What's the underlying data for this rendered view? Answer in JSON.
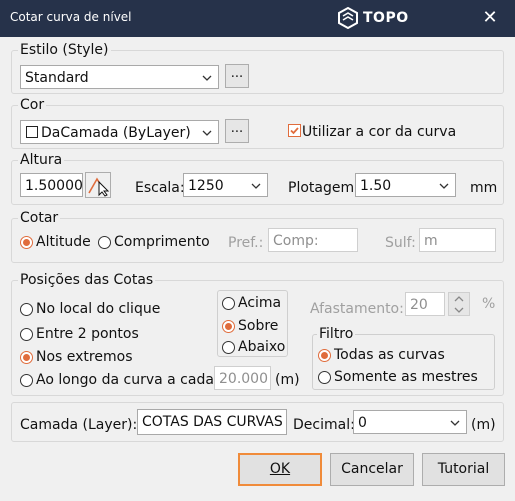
{
  "window": {
    "title": "Cotar curva de nível",
    "logo_text": "TOPO",
    "close_glyph": "✕"
  },
  "estilo": {
    "legend": "Estilo (Style)",
    "value": "Standard",
    "more_label": "..."
  },
  "cor": {
    "legend": "Cor",
    "value": "DaCamada (ByLayer)",
    "more_label": "...",
    "use_curve_color_label": "Utilizar a cor da curva",
    "use_curve_color_checked": true
  },
  "altura": {
    "legend": "Altura",
    "value": "1.50000",
    "escala_label": "Escala:",
    "escala_value": "1250",
    "plotagem_label": "Plotagem:",
    "plotagem_value": "1.50",
    "unit": "mm"
  },
  "cotar": {
    "legend": "Cotar",
    "options": [
      {
        "label": "Altitude",
        "checked": true
      },
      {
        "label": "Comprimento",
        "checked": false
      }
    ],
    "pref_label": "Pref.:",
    "pref_placeholder": "Comp:",
    "sulf_label": "Sulf:",
    "sulf_placeholder": "m"
  },
  "posicoes": {
    "legend": "Posições das Cotas",
    "options": [
      {
        "label": "No local do clique",
        "checked": false
      },
      {
        "label": "Entre 2 pontos",
        "checked": false
      },
      {
        "label": "Nos extremos",
        "checked": true
      },
      {
        "label": "Ao longo da curva a cada:",
        "checked": false
      }
    ],
    "interval_value": "20.000",
    "interval_unit": "(m)",
    "vertical": [
      {
        "label": "Acima",
        "checked": false
      },
      {
        "label": "Sobre",
        "checked": true
      },
      {
        "label": "Abaixo",
        "checked": false
      }
    ],
    "afastamento_label": "Afastamento:",
    "afastamento_value": "20",
    "afastamento_unit": "%",
    "filtro": {
      "legend": "Filtro",
      "options": [
        {
          "label": "Todas as curvas",
          "checked": true
        },
        {
          "label": "Somente as mestres",
          "checked": false
        }
      ]
    }
  },
  "camada": {
    "label": "Camada (Layer):",
    "value": "COTAS DAS CURVAS",
    "decimal_label": "Decimal:",
    "decimal_value": "0",
    "decimal_unit": "(m)"
  },
  "buttons": {
    "ok": "OK",
    "cancel": "Cancelar",
    "tutorial": "Tutorial"
  },
  "colors": {
    "titlebar": "#26324a",
    "accent": "#e06c3c",
    "focus": "#f08b3a"
  }
}
